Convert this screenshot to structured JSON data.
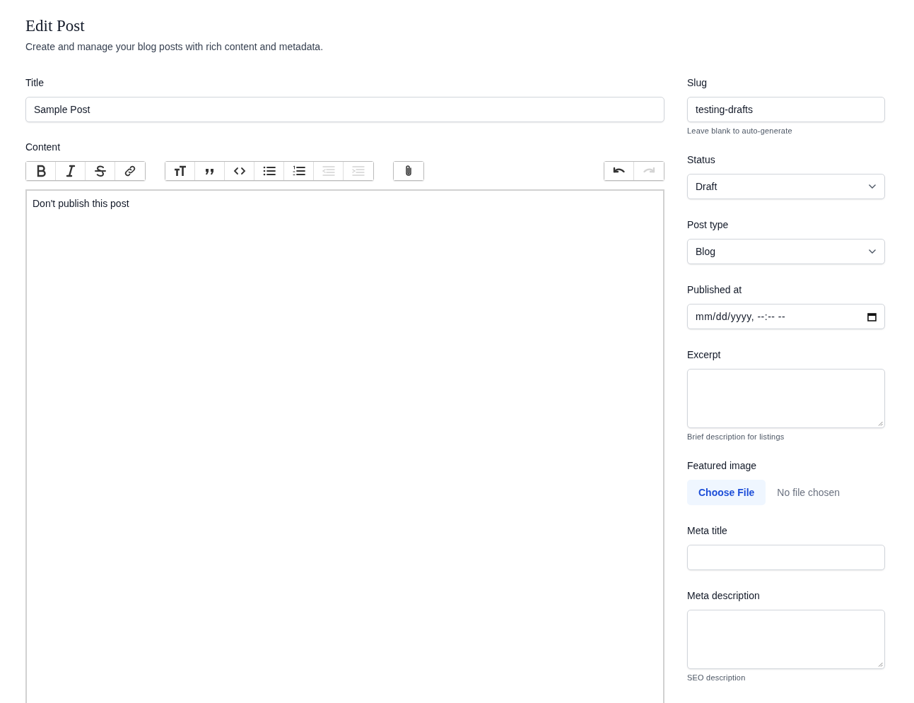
{
  "header": {
    "title": "Edit Post",
    "subtitle": "Create and manage your blog posts with rich content and metadata."
  },
  "title_field": {
    "label": "Title",
    "value": "Sample Post"
  },
  "content": {
    "label": "Content",
    "value": "Don't publish this post",
    "toolbar_left": [
      {
        "buttons": [
          {
            "kind": "bold",
            "disabled": false
          },
          {
            "kind": "italic",
            "disabled": false
          },
          {
            "kind": "strike",
            "disabled": false
          },
          {
            "kind": "link",
            "disabled": false
          }
        ]
      },
      {
        "buttons": [
          {
            "kind": "heading",
            "disabled": false
          },
          {
            "kind": "quote",
            "disabled": false
          },
          {
            "kind": "code",
            "disabled": false
          },
          {
            "kind": "bullets",
            "disabled": false
          },
          {
            "kind": "numbers",
            "disabled": false
          },
          {
            "kind": "outdent",
            "disabled": true
          },
          {
            "kind": "indent",
            "disabled": true
          }
        ]
      },
      {
        "buttons": [
          {
            "kind": "attach",
            "disabled": false
          }
        ]
      }
    ],
    "toolbar_right": [
      {
        "buttons": [
          {
            "kind": "undo",
            "disabled": false
          },
          {
            "kind": "redo",
            "disabled": true
          }
        ]
      }
    ]
  },
  "sidebar_fields": [
    {
      "kind": "text",
      "label": "Slug",
      "value": "testing-drafts",
      "hint": "Leave blank to auto-generate"
    },
    {
      "kind": "select",
      "label": "Status",
      "value": "Draft"
    },
    {
      "kind": "select",
      "label": "Post type",
      "value": "Blog"
    },
    {
      "kind": "datetime",
      "label": "Published at",
      "value": "mm/dd/yyyy, --:-- --"
    },
    {
      "kind": "textarea",
      "label": "Excerpt",
      "hint": "Brief description for listings"
    },
    {
      "kind": "file",
      "label": "Featured image",
      "button": "Choose File",
      "status": "No file chosen"
    },
    {
      "kind": "text",
      "label": "Meta title"
    },
    {
      "kind": "textarea",
      "label": "Meta description",
      "hint": "SEO description"
    }
  ]
}
